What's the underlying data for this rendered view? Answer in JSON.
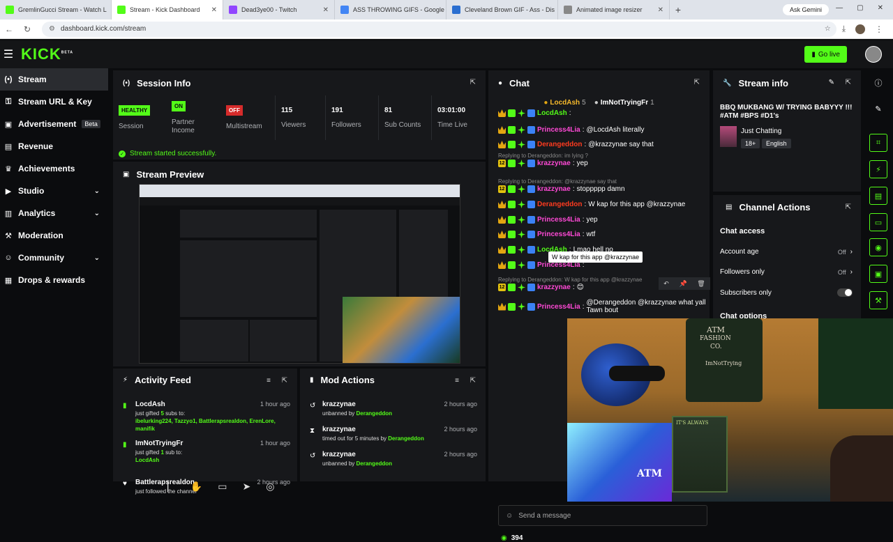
{
  "browser": {
    "tabs": [
      {
        "title": "GremlinGucci Stream - Watch L",
        "color": "#53fc18",
        "active": false
      },
      {
        "title": "Stream - Kick Dashboard",
        "color": "#53fc18",
        "active": true
      },
      {
        "title": "Dead3ye00 - Twitch",
        "color": "#9146ff",
        "active": false
      },
      {
        "title": "ASS THROWING GIFS - Google",
        "color": "#4285f4",
        "active": false
      },
      {
        "title": "Cleveland Brown GIF - Ass - Dis",
        "color": "#2b6fd0",
        "active": false
      },
      {
        "title": "Animated image resizer",
        "color": "#888888",
        "active": false
      }
    ],
    "ask_gemini": "Ask Gemini",
    "url": "dashboard.kick.com/stream"
  },
  "header": {
    "logo": "KICK",
    "logo_badge": "BETA",
    "go_live": "Go live"
  },
  "sidebar": {
    "items": [
      {
        "label": "Stream",
        "icon": "broadcast-icon",
        "glyph": "(•)",
        "active": true,
        "chevron": false
      },
      {
        "label": "Stream URL & Key",
        "icon": "key-icon",
        "glyph": "⚿",
        "active": false,
        "chevron": false
      },
      {
        "label": "Advertisement",
        "icon": "ad-icon",
        "glyph": "▣",
        "active": false,
        "chevron": false,
        "badge": "Beta"
      },
      {
        "label": "Revenue",
        "icon": "revenue-icon",
        "glyph": "▤",
        "active": false,
        "chevron": false
      },
      {
        "label": "Achievements",
        "icon": "trophy-icon",
        "glyph": "♛",
        "active": false,
        "chevron": false
      },
      {
        "label": "Studio",
        "icon": "studio-icon",
        "glyph": "▶",
        "active": false,
        "chevron": true
      },
      {
        "label": "Analytics",
        "icon": "analytics-icon",
        "glyph": "▥",
        "active": false,
        "chevron": true
      },
      {
        "label": "Moderation",
        "icon": "hammer-icon",
        "glyph": "⚒",
        "active": false,
        "chevron": false
      },
      {
        "label": "Community",
        "icon": "community-icon",
        "glyph": "☺",
        "active": false,
        "chevron": true
      },
      {
        "label": "Drops & rewards",
        "icon": "drops-icon",
        "glyph": "▦",
        "active": false,
        "chevron": false
      }
    ]
  },
  "session": {
    "title": "Session Info",
    "health_badge": "HEALTHY",
    "health_label": "Session",
    "partner_badge": "ON",
    "partner_label": "Partner Income",
    "multistream_badge": "OFF",
    "multistream_label": "Multistream",
    "viewers_value": "115",
    "viewers_label": "Viewers",
    "followers_value": "191",
    "followers_label": "Followers",
    "subs_value": "81",
    "subs_label": "Sub Counts",
    "time_value": "03:01:00",
    "time_label": "Time Live",
    "success": "Stream started successfully."
  },
  "preview": {
    "title": "Stream Preview"
  },
  "activity": {
    "title": "Activity Feed",
    "items": [
      {
        "name": "LocdAsh",
        "time": "1 hour ago",
        "desc_pre": "just gifted ",
        "desc_count": "5",
        "desc_mid": " subs to:",
        "desc_names": "ibelurking224, Tazzyo1, Battlerapsrealdon, ErenLore, manifik"
      },
      {
        "name": "ImNotTryingFr",
        "time": "1 hour ago",
        "desc_pre": "just gifted ",
        "desc_count": "1",
        "desc_mid": " sub to: ",
        "desc_names": "LocdAsh"
      },
      {
        "name": "Battlerapsrealdon",
        "time": "2 hours ago",
        "desc_pre": "just followed the channel",
        "desc_count": "",
        "desc_mid": "",
        "desc_names": ""
      }
    ]
  },
  "mod_actions": {
    "title": "Mod Actions",
    "items": [
      {
        "name": "krazzynae",
        "time": "2 hours ago",
        "action": "unbanned by ",
        "by": "Derangeddon",
        "icon": "undo-icon",
        "glyph": "↺"
      },
      {
        "name": "krazzynae",
        "time": "2 hours ago",
        "action": "timed out for 5 minutes by ",
        "by": "Derangeddon",
        "icon": "hourglass-icon",
        "glyph": "⧗"
      },
      {
        "name": "krazzynae",
        "time": "2 hours ago",
        "action": "unbanned by ",
        "by": "Derangeddon",
        "icon": "undo-icon",
        "glyph": "↺"
      }
    ]
  },
  "chat": {
    "title": "Chat",
    "pinned": [
      {
        "name": "LocdAsh",
        "count": "5"
      },
      {
        "name": "ImNotTryingFr",
        "count": "1"
      }
    ],
    "messages": [
      {
        "user": "LocdAsh",
        "color": "green",
        "text": "",
        "reply": ""
      },
      {
        "user": "Princess4Lia",
        "color": "pink",
        "text": "@LocdAsh literally",
        "reply": ""
      },
      {
        "user": "Derangeddon",
        "color": "red",
        "text": "@krazzynae say that",
        "reply": ""
      },
      {
        "user": "krazzynae",
        "color": "pink",
        "text": "yep",
        "reply": "Replying to Derangeddon: im lying ?"
      },
      {
        "user": "krazzynae",
        "color": "pink",
        "text": "stoppppp damn",
        "reply": "Replying to Derangeddon: @krazzynae say that"
      },
      {
        "user": "Derangeddon",
        "color": "red",
        "text": "W kap for this app @krazzynae",
        "reply": ""
      },
      {
        "user": "Princess4Lia",
        "color": "pink",
        "text": "yep",
        "reply": ""
      },
      {
        "user": "Princess4Lia",
        "color": "pink",
        "text": "wtf",
        "reply": ""
      },
      {
        "user": "LocdAsh",
        "color": "green",
        "text": "Lmao hell no",
        "reply": ""
      },
      {
        "user": "Princess4Lia",
        "color": "pink",
        "text": "",
        "reply": ""
      },
      {
        "user": "krazzynae",
        "color": "pink",
        "text": "😊",
        "reply": "Replying to Derangeddon: W kap for this app @krazzynae"
      },
      {
        "user": "Princess4Lia",
        "color": "pink",
        "text": "@Derangeddon @krazzynae what yall Tawn bout",
        "reply": ""
      }
    ],
    "tooltip": "W kap for this app @krazzynae",
    "input_placeholder": "Send a message",
    "viewer_count": "394"
  },
  "stream_info": {
    "title": "Stream info",
    "stream_title": "BBQ MUKBANG W/ TRYING BABYYY !!! #ATM #BPS #D1's",
    "category": "Just Chatting",
    "tags": [
      "18+",
      "English"
    ]
  },
  "channel_actions": {
    "title": "Channel Actions",
    "chat_access": "Chat access",
    "account_age_label": "Account age",
    "account_age_value": "Off",
    "followers_only_label": "Followers only",
    "followers_only_value": "Off",
    "subscribers_only_label": "Subscribers only",
    "chat_options": "Chat options"
  },
  "webcam": {
    "shirt_text_1": "ATM",
    "shirt_text_2": "FASHION",
    "shirt_text_3": "CO.",
    "shirt_text_4": "ImNotTrying",
    "sign_text": "IT'S ALWAYS",
    "box_text": "ATM"
  },
  "colors": {
    "kick_green": "#53fc18",
    "panel_bg": "#17181b",
    "page_bg": "#0b0c0e"
  }
}
